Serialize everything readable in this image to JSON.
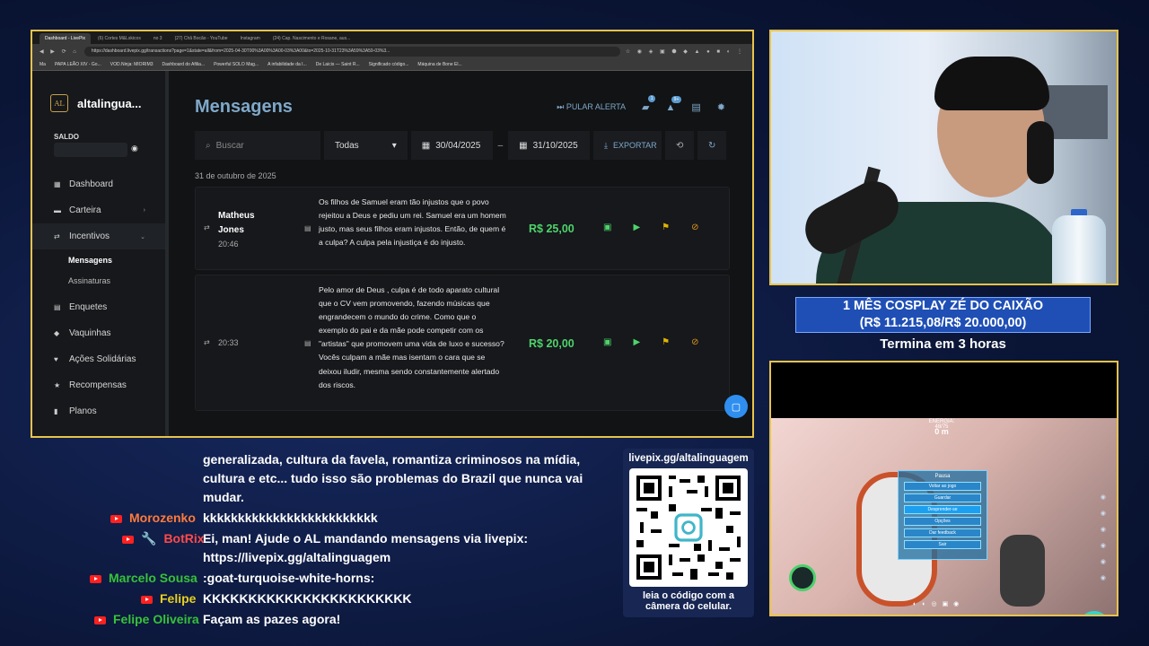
{
  "browser": {
    "tabs": [
      "Dashboard - LivePix",
      "(6) Cortes M&Lskicos",
      "no 3",
      "(27) Chã Bocão - YouTube",
      "Instagram",
      "(24) Cap. Nascimento e Rosane, aus..."
    ],
    "url": "https://dashboard.livepix.gg/transactions?page=1&state=all&from=2025-04-30T00%3A00%3A00-03%3A00&to=2025-10-31T23%3A59%3A59-03%3...",
    "bookmarks": [
      "Ma",
      "PAPA LEÃO XIV - Go...",
      "VOD.Ninja: MIORIM3",
      "Dashboard do Afiliа...",
      "Powerful SOLO Mag...",
      "A infabilidade da I...",
      "De Laicis — Saint R...",
      "Significado código...",
      "Máquina de Bone El..."
    ]
  },
  "app": {
    "logo_mark": "AL",
    "name": "altalingua...",
    "saldo_label": "SALDO",
    "nav": [
      {
        "label": "Dashboard",
        "icon": "dashboard-icon"
      },
      {
        "label": "Carteira",
        "icon": "wallet-icon"
      },
      {
        "label": "Incentivos",
        "icon": "incentives-icon"
      },
      {
        "label": "Enquetes",
        "icon": "poll-icon"
      },
      {
        "label": "Vaquinhas",
        "icon": "crowdfund-icon"
      },
      {
        "label": "Ações Solidárias",
        "icon": "charity-icon"
      },
      {
        "label": "Recompensas",
        "icon": "reward-icon"
      },
      {
        "label": "Planos",
        "icon": "plans-icon"
      }
    ],
    "subnav": [
      "Mensagens",
      "Assinaturas"
    ],
    "title": "Mensagens",
    "skip_alert": "PULAR ALERTA",
    "badges": [
      "1",
      "9+"
    ],
    "search_placeholder": "Buscar",
    "filter_value": "Todas",
    "date_from": "30/04/2025",
    "date_sep": "–",
    "date_to": "31/10/2025",
    "export_label": "EXPORTAR",
    "date_header": "31 de outubro de 2025",
    "messages": [
      {
        "name": "Matheus Jones",
        "time": "20:46",
        "text": "Os filhos de Samuel eram tão injustos que o povo rejeitou a Deus e pediu um rei. Samuel era um homem justo, mas seus filhos eram injustos. Então, de quem é a culpa? A culpa pela injustiça é do injusto.",
        "value": "R$ 25,00"
      },
      {
        "name": "",
        "time": "20:33",
        "text": "Pelo amor de Deus , culpa é de todo aparato cultural que o CV vem promovendo, fazendo músicas que engrandecem o mundo do crime. Como que o exemplo do pai e da mãe pode competir com os \"artistas\" que promovem uma vida de luxo e sucesso? Vocês culpam a mãe mas isentam o cara que se deixou iludir, mesma sendo constantemente alertado dos riscos.",
        "value": "R$ 20,00"
      }
    ]
  },
  "goal": {
    "line1": "1 MÊS COSPLAY ZÉ DO CAIXÃO",
    "line2": "(R$ 11.215,08/R$ 20.000,00)",
    "current": 11215.08,
    "target": 20000,
    "ends": "Termina em 3 horas"
  },
  "game": {
    "energy": "ENERGIA: 48/75",
    "depth": "0 m",
    "pause_title": "Pausa",
    "pause_options": [
      "Voltar ao jogo",
      "Guardar",
      "Desprender-se",
      "Opções",
      "Dar feedback",
      "Sair"
    ]
  },
  "chat": {
    "continuation": [
      "generalizada, cultura da favela, romantiza criminosos na mídia,",
      "cultura e etc... tudo isso são problemas do Brazil que nunca vai",
      "mudar."
    ],
    "lines": [
      {
        "user": "Morozenko",
        "color": "#ff7a3c",
        "text": "kkkkkkkkkkkkkkkkkkkkkkkkk"
      },
      {
        "user": "BotRix",
        "color": "#ff4a4a",
        "text": "Ei, man! Ajude o AL mandando mensagens via livepix:",
        "text2": "https://livepix.gg/altalinguagem"
      },
      {
        "user": "Marcelo Sousa",
        "color": "#36c23a",
        "text": ":goat-turquoise-white-horns:"
      },
      {
        "user": "Felipe",
        "color": "#e6d020",
        "text": "KKKKKKKKKKKKKKKKKKKKKKK"
      },
      {
        "user": "Felipe Oliveira",
        "color": "#36c23a",
        "text": "Façam as pazes agora!"
      }
    ]
  },
  "qr": {
    "url": "livepix.gg/altalinguagem",
    "caption1": "leia o código com a",
    "caption2": "câmera do celular."
  }
}
